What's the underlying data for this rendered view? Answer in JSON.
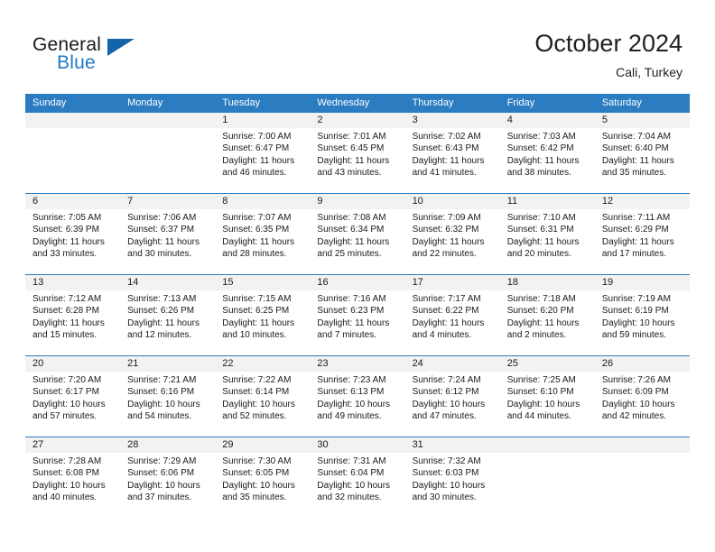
{
  "brand": {
    "name_part1": "General",
    "name_part2": "Blue",
    "flag_icon": "triangle-flag-icon",
    "accent_color": "#1f7ac4"
  },
  "header": {
    "title": "October 2024",
    "subtitle": "Cali, Turkey"
  },
  "theme": {
    "header_blue": "#2b7cc1",
    "daterow_gray": "#f2f2f2",
    "text": "#1a1a1a"
  },
  "weekdays": [
    "Sunday",
    "Monday",
    "Tuesday",
    "Wednesday",
    "Thursday",
    "Friday",
    "Saturday"
  ],
  "weeks": [
    {
      "days": [
        {
          "num": "",
          "lines": [
            "",
            "",
            "",
            ""
          ]
        },
        {
          "num": "",
          "lines": [
            "",
            "",
            "",
            ""
          ]
        },
        {
          "num": "1",
          "lines": [
            "Sunrise: 7:00 AM",
            "Sunset: 6:47 PM",
            "Daylight: 11 hours",
            "and 46 minutes."
          ]
        },
        {
          "num": "2",
          "lines": [
            "Sunrise: 7:01 AM",
            "Sunset: 6:45 PM",
            "Daylight: 11 hours",
            "and 43 minutes."
          ]
        },
        {
          "num": "3",
          "lines": [
            "Sunrise: 7:02 AM",
            "Sunset: 6:43 PM",
            "Daylight: 11 hours",
            "and 41 minutes."
          ]
        },
        {
          "num": "4",
          "lines": [
            "Sunrise: 7:03 AM",
            "Sunset: 6:42 PM",
            "Daylight: 11 hours",
            "and 38 minutes."
          ]
        },
        {
          "num": "5",
          "lines": [
            "Sunrise: 7:04 AM",
            "Sunset: 6:40 PM",
            "Daylight: 11 hours",
            "and 35 minutes."
          ]
        }
      ]
    },
    {
      "days": [
        {
          "num": "6",
          "lines": [
            "Sunrise: 7:05 AM",
            "Sunset: 6:39 PM",
            "Daylight: 11 hours",
            "and 33 minutes."
          ]
        },
        {
          "num": "7",
          "lines": [
            "Sunrise: 7:06 AM",
            "Sunset: 6:37 PM",
            "Daylight: 11 hours",
            "and 30 minutes."
          ]
        },
        {
          "num": "8",
          "lines": [
            "Sunrise: 7:07 AM",
            "Sunset: 6:35 PM",
            "Daylight: 11 hours",
            "and 28 minutes."
          ]
        },
        {
          "num": "9",
          "lines": [
            "Sunrise: 7:08 AM",
            "Sunset: 6:34 PM",
            "Daylight: 11 hours",
            "and 25 minutes."
          ]
        },
        {
          "num": "10",
          "lines": [
            "Sunrise: 7:09 AM",
            "Sunset: 6:32 PM",
            "Daylight: 11 hours",
            "and 22 minutes."
          ]
        },
        {
          "num": "11",
          "lines": [
            "Sunrise: 7:10 AM",
            "Sunset: 6:31 PM",
            "Daylight: 11 hours",
            "and 20 minutes."
          ]
        },
        {
          "num": "12",
          "lines": [
            "Sunrise: 7:11 AM",
            "Sunset: 6:29 PM",
            "Daylight: 11 hours",
            "and 17 minutes."
          ]
        }
      ]
    },
    {
      "days": [
        {
          "num": "13",
          "lines": [
            "Sunrise: 7:12 AM",
            "Sunset: 6:28 PM",
            "Daylight: 11 hours",
            "and 15 minutes."
          ]
        },
        {
          "num": "14",
          "lines": [
            "Sunrise: 7:13 AM",
            "Sunset: 6:26 PM",
            "Daylight: 11 hours",
            "and 12 minutes."
          ]
        },
        {
          "num": "15",
          "lines": [
            "Sunrise: 7:15 AM",
            "Sunset: 6:25 PM",
            "Daylight: 11 hours",
            "and 10 minutes."
          ]
        },
        {
          "num": "16",
          "lines": [
            "Sunrise: 7:16 AM",
            "Sunset: 6:23 PM",
            "Daylight: 11 hours",
            "and 7 minutes."
          ]
        },
        {
          "num": "17",
          "lines": [
            "Sunrise: 7:17 AM",
            "Sunset: 6:22 PM",
            "Daylight: 11 hours",
            "and 4 minutes."
          ]
        },
        {
          "num": "18",
          "lines": [
            "Sunrise: 7:18 AM",
            "Sunset: 6:20 PM",
            "Daylight: 11 hours",
            "and 2 minutes."
          ]
        },
        {
          "num": "19",
          "lines": [
            "Sunrise: 7:19 AM",
            "Sunset: 6:19 PM",
            "Daylight: 10 hours",
            "and 59 minutes."
          ]
        }
      ]
    },
    {
      "days": [
        {
          "num": "20",
          "lines": [
            "Sunrise: 7:20 AM",
            "Sunset: 6:17 PM",
            "Daylight: 10 hours",
            "and 57 minutes."
          ]
        },
        {
          "num": "21",
          "lines": [
            "Sunrise: 7:21 AM",
            "Sunset: 6:16 PM",
            "Daylight: 10 hours",
            "and 54 minutes."
          ]
        },
        {
          "num": "22",
          "lines": [
            "Sunrise: 7:22 AM",
            "Sunset: 6:14 PM",
            "Daylight: 10 hours",
            "and 52 minutes."
          ]
        },
        {
          "num": "23",
          "lines": [
            "Sunrise: 7:23 AM",
            "Sunset: 6:13 PM",
            "Daylight: 10 hours",
            "and 49 minutes."
          ]
        },
        {
          "num": "24",
          "lines": [
            "Sunrise: 7:24 AM",
            "Sunset: 6:12 PM",
            "Daylight: 10 hours",
            "and 47 minutes."
          ]
        },
        {
          "num": "25",
          "lines": [
            "Sunrise: 7:25 AM",
            "Sunset: 6:10 PM",
            "Daylight: 10 hours",
            "and 44 minutes."
          ]
        },
        {
          "num": "26",
          "lines": [
            "Sunrise: 7:26 AM",
            "Sunset: 6:09 PM",
            "Daylight: 10 hours",
            "and 42 minutes."
          ]
        }
      ]
    },
    {
      "days": [
        {
          "num": "27",
          "lines": [
            "Sunrise: 7:28 AM",
            "Sunset: 6:08 PM",
            "Daylight: 10 hours",
            "and 40 minutes."
          ]
        },
        {
          "num": "28",
          "lines": [
            "Sunrise: 7:29 AM",
            "Sunset: 6:06 PM",
            "Daylight: 10 hours",
            "and 37 minutes."
          ]
        },
        {
          "num": "29",
          "lines": [
            "Sunrise: 7:30 AM",
            "Sunset: 6:05 PM",
            "Daylight: 10 hours",
            "and 35 minutes."
          ]
        },
        {
          "num": "30",
          "lines": [
            "Sunrise: 7:31 AM",
            "Sunset: 6:04 PM",
            "Daylight: 10 hours",
            "and 32 minutes."
          ]
        },
        {
          "num": "31",
          "lines": [
            "Sunrise: 7:32 AM",
            "Sunset: 6:03 PM",
            "Daylight: 10 hours",
            "and 30 minutes."
          ]
        },
        {
          "num": "",
          "lines": [
            "",
            "",
            "",
            ""
          ]
        },
        {
          "num": "",
          "lines": [
            "",
            "",
            "",
            ""
          ]
        }
      ]
    }
  ]
}
